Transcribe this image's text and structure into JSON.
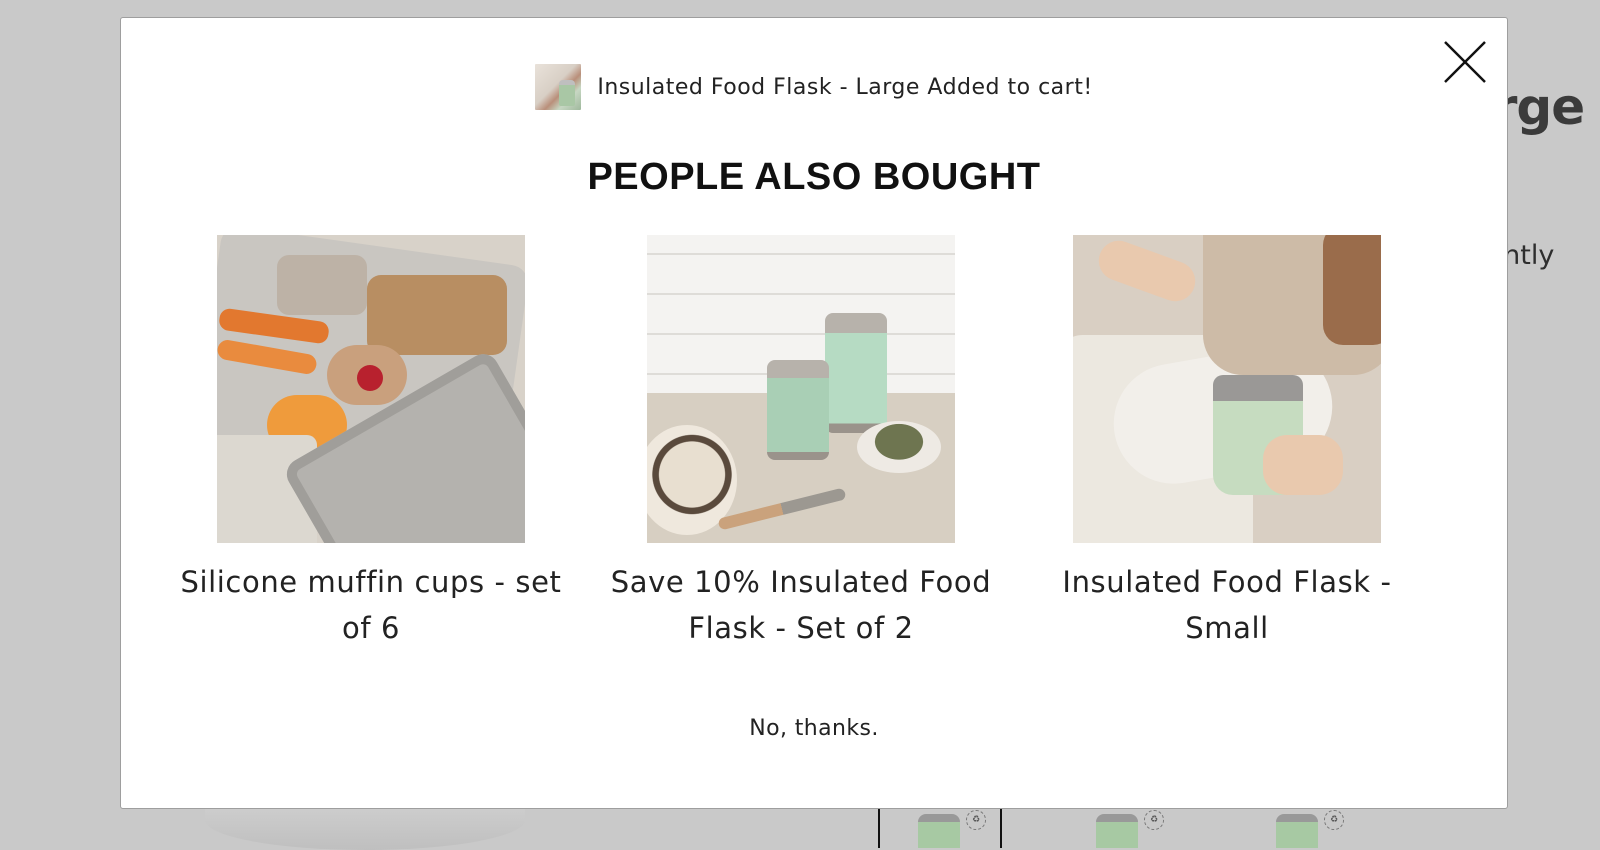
{
  "background_page": {
    "title_fragment": "arge",
    "text_fragment": "ghtly"
  },
  "modal": {
    "close_icon": "close-icon",
    "added_message": "Insulated Food Flask - Large Added to cart!",
    "heading": "PEOPLE ALSO BOUGHT",
    "products": [
      {
        "name": "Silicone muffin cups - set of 6"
      },
      {
        "name": "Save 10% Insulated Food Flask - Set of 2"
      },
      {
        "name": "Insulated Food Flask - Small"
      }
    ],
    "decline_label": "No, thanks."
  },
  "colors": {
    "overlay": "#c9c9c9",
    "modal_bg": "#ffffff",
    "text": "#222222",
    "heading": "#111111"
  }
}
